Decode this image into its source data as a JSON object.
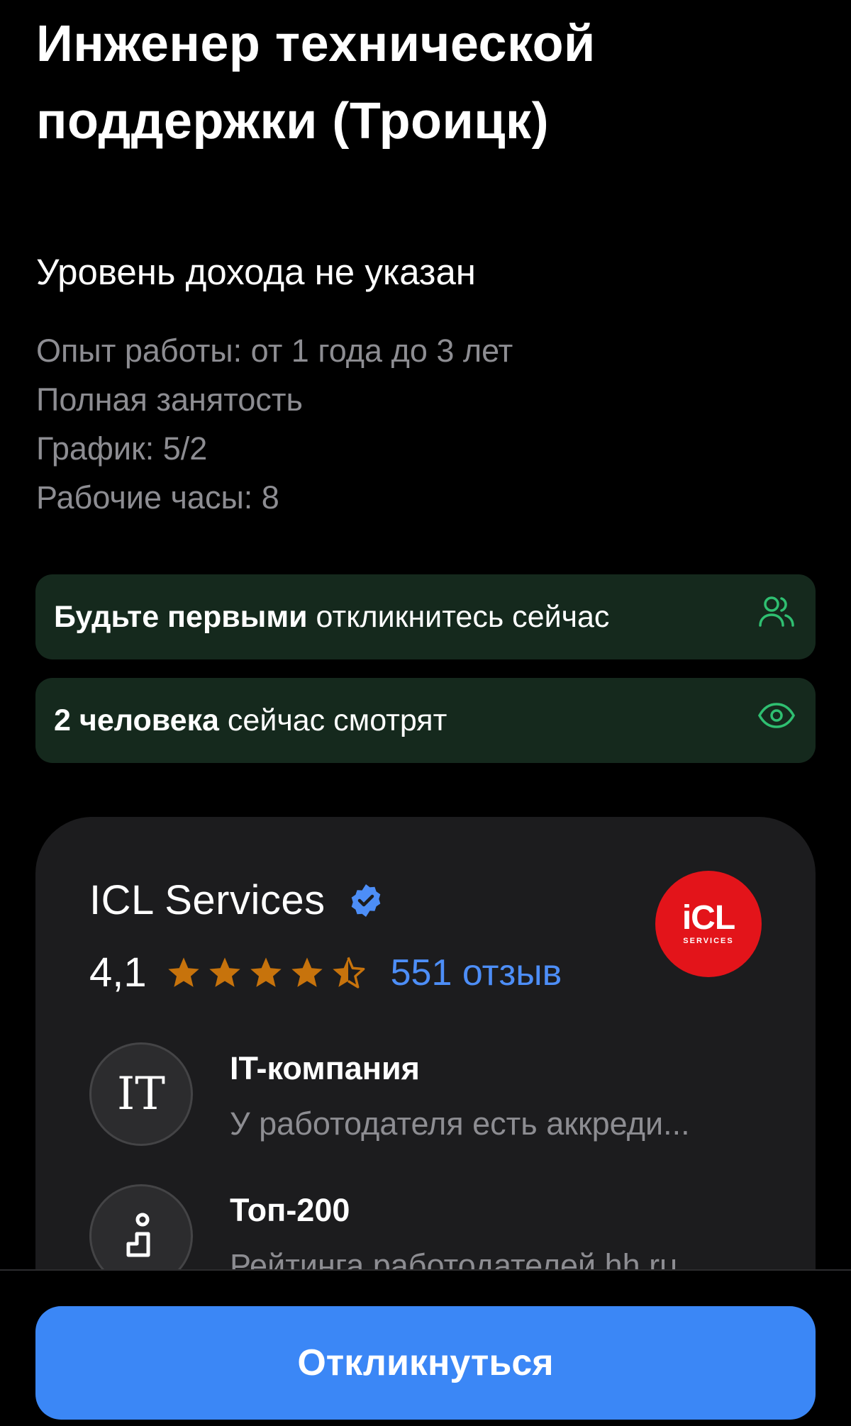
{
  "vacancy": {
    "title": "Инженер технической поддержки (Троицк)",
    "income": "Уровень дохода не указан",
    "details": [
      "Опыт работы: от 1 года до 3 лет",
      "Полная занятость",
      "График: 5/2",
      "Рабочие часы: 8"
    ]
  },
  "banners": {
    "first": {
      "bold": "Будьте первыми",
      "text": " откликнитесь сейчас",
      "icon": "people-icon"
    },
    "viewers": {
      "bold": "2 человека",
      "text": " сейчас смотрят",
      "icon": "eye-icon"
    }
  },
  "company": {
    "name": "ICL Services",
    "verified_icon": "verified-badge-icon",
    "logo_main": "iCL",
    "logo_sub": "SERVICES",
    "rating": "4,1",
    "stars": 4.5,
    "reviews": "551 отзыв",
    "features": [
      {
        "icon_text": "IT",
        "title": "IT-компания",
        "subtitle": "У работодателя есть аккреди..."
      },
      {
        "icon": "top-rank-icon",
        "title": "Топ-200",
        "subtitle": "Рейтинга работодателей hh.ru"
      }
    ]
  },
  "actions": {
    "apply_label": "Откликнуться"
  },
  "colors": {
    "background": "#000000",
    "banner_bg": "#15291d",
    "banner_icon": "#2fbf71",
    "card_bg": "#1c1c1e",
    "star": "#c7730c",
    "link": "#4d8ef7",
    "primary_button": "#3b87f6",
    "logo_red": "#e3141a"
  }
}
